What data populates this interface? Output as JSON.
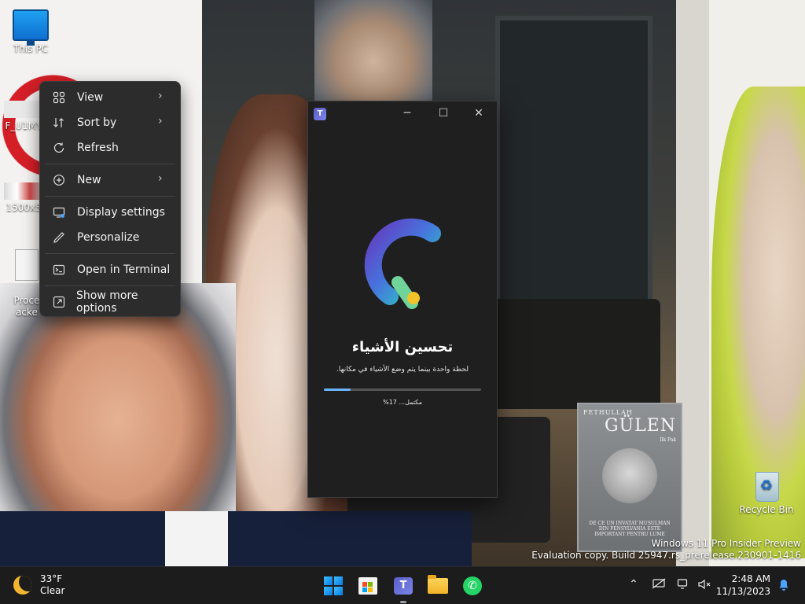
{
  "desktop": {
    "icons": [
      {
        "label": "This PC"
      },
      {
        "label": "F_U1MY"
      },
      {
        "label": "1500x5"
      },
      {
        "label": "Proce\nacke"
      },
      {
        "label": "Recycle Bin"
      }
    ],
    "watermark": {
      "line1": "Windows 11 Pro Insider Preview",
      "line2": "Evaluation copy. Build 25947.rs_prerelease.230901-1416"
    },
    "wallpaper_book": {
      "author_line": "FETHULLAH",
      "author_name": "GÜLEN",
      "subtitle": "Ilk Pak",
      "cover_text": "DE CE UN INVATAT MUSULMAN DIN PENSYLVANIA ESTE IMPORTANT PENTRU LUME"
    }
  },
  "context_menu": {
    "items": [
      {
        "label": "View",
        "icon": "grid-icon",
        "submenu": true
      },
      {
        "label": "Sort by",
        "icon": "sort-icon",
        "submenu": true
      },
      {
        "label": "Refresh",
        "icon": "refresh-icon",
        "submenu": false
      },
      {
        "label": "New",
        "icon": "plus-circle-icon",
        "submenu": true
      },
      {
        "label": "Display settings",
        "icon": "display-icon",
        "submenu": false
      },
      {
        "label": "Personalize",
        "icon": "pen-icon",
        "submenu": false
      },
      {
        "label": "Open in Terminal",
        "icon": "terminal-icon",
        "submenu": false
      },
      {
        "label": "Show more options",
        "icon": "external-icon",
        "submenu": false
      }
    ]
  },
  "teams_window": {
    "heading": "تحسين الأشياء",
    "subtitle": "لحظة واحدة بينما يتم وضع الأشياء في مكانها.",
    "progress_text": "مكتمل... 17%",
    "progress_fraction": 0.17,
    "accent_color": "#6ab5ff"
  },
  "taskbar": {
    "weather": {
      "temp": "33°F",
      "condition": "Clear"
    },
    "apps": [
      "start",
      "microsoft-store",
      "teams",
      "file-explorer",
      "whatsapp"
    ],
    "clock": {
      "time": "2:48 AM",
      "date": "11/13/2023"
    }
  }
}
